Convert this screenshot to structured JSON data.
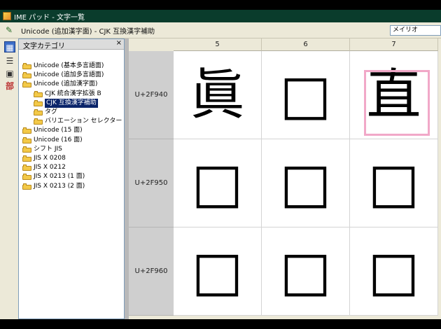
{
  "window": {
    "title": "IME パッド - 文字一覧"
  },
  "toolbar": {
    "breadcrumb": "Unicode (追加漢字面) - CJK 互換漢字補助",
    "font_value": "メイリオ"
  },
  "left_strip": {
    "icons": [
      "pencil-icon",
      "grid-icon",
      "strokes-icon",
      "screen-icon",
      "radical-icon"
    ],
    "radical_label": "部"
  },
  "category_panel": {
    "header": "文字カテゴリ",
    "close": "×",
    "items": [
      {
        "label": "Unicode (基本多言語面)",
        "indent": 0,
        "selected": false
      },
      {
        "label": "Unicode (追加多言語面)",
        "indent": 0,
        "selected": false
      },
      {
        "label": "Unicode (追加漢字面)",
        "indent": 0,
        "selected": false
      },
      {
        "label": "CJK 統合漢字拡張 B",
        "indent": 1,
        "selected": false
      },
      {
        "label": "CJK 互換漢字補助",
        "indent": 1,
        "selected": true
      },
      {
        "label": "タグ",
        "indent": 1,
        "selected": false
      },
      {
        "label": "バリエーション セレクター",
        "indent": 1,
        "selected": false
      },
      {
        "label": "Unicode (15 面)",
        "indent": 0,
        "selected": false
      },
      {
        "label": "Unicode (16 面)",
        "indent": 0,
        "selected": false
      },
      {
        "label": "シフト JIS",
        "indent": 0,
        "selected": false
      },
      {
        "label": "JIS X 0208",
        "indent": 0,
        "selected": false
      },
      {
        "label": "JIS X 0212",
        "indent": 0,
        "selected": false
      },
      {
        "label": "JIS X 0213 (1 面)",
        "indent": 0,
        "selected": false
      },
      {
        "label": "JIS X 0213 (2 面)",
        "indent": 0,
        "selected": false
      }
    ]
  },
  "grid": {
    "columns": [
      "5",
      "6",
      "7"
    ],
    "rows": [
      {
        "code": "U+2F940",
        "cells": [
          "眞",
          "□",
          "直"
        ]
      },
      {
        "code": "U+2F950",
        "cells": [
          "□",
          "□",
          "□"
        ]
      },
      {
        "code": "U+2F960",
        "cells": [
          "□",
          "□",
          "□"
        ]
      }
    ],
    "highlighted_cell": {
      "row": 0,
      "col": 2
    },
    "highlight_color": "#f1a8c8"
  },
  "colors": {
    "titlebar": "#0a3c2c",
    "selection": "#0a246a",
    "row_header": "#cfcfcf"
  }
}
